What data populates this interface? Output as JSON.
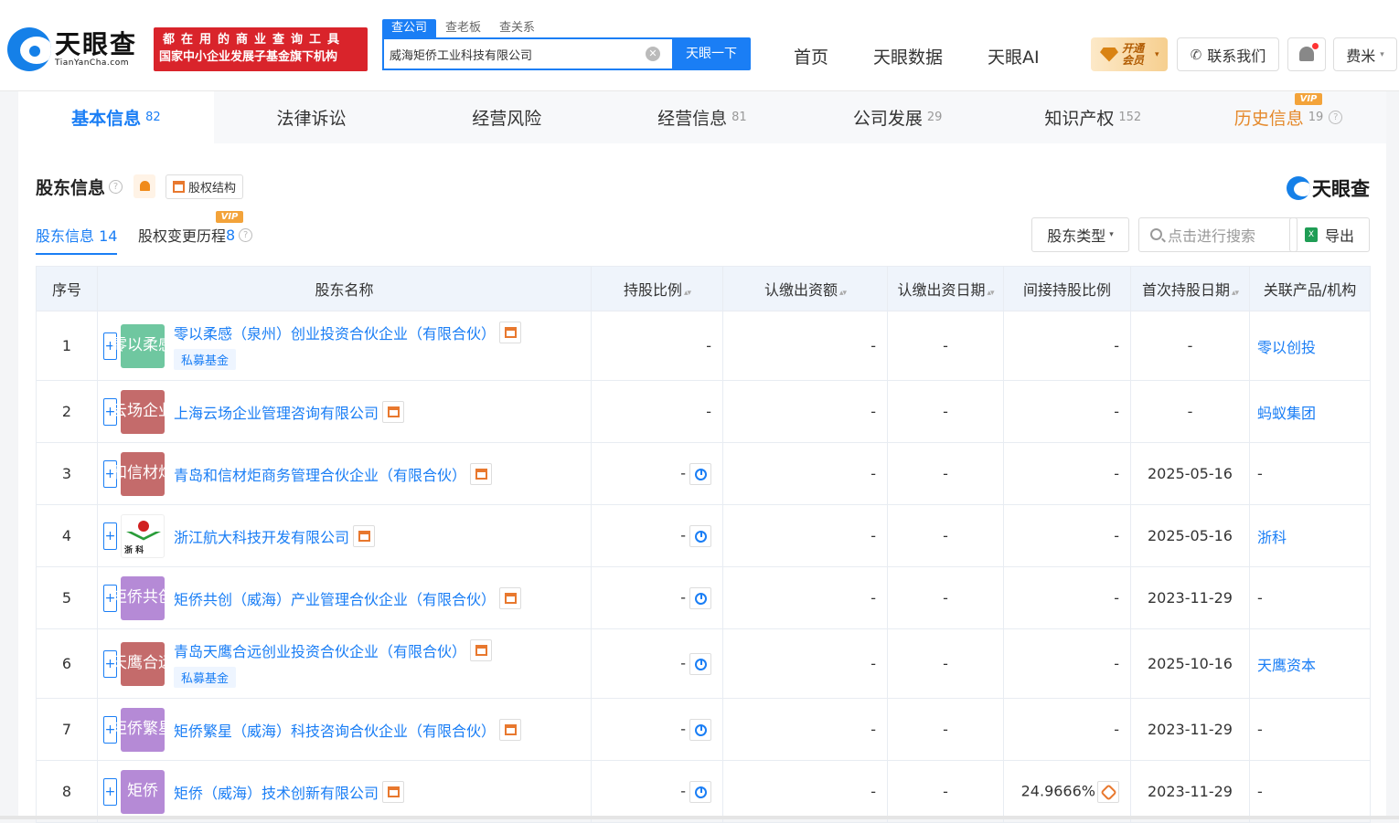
{
  "header": {
    "logo_title": "天眼查",
    "logo_sub": "TianYanCha.com",
    "banner_line1": "都在用的商业查询工具",
    "banner_line2": "国家中小企业发展子基金旗下机构",
    "search_tabs": [
      "查公司",
      "查老板",
      "查关系"
    ],
    "search_value": "威海矩侨工业科技有限公司",
    "search_button": "天眼一下",
    "nav": [
      "首页",
      "天眼数据",
      "天眼AI"
    ],
    "vip_label": "开通会员",
    "contact_label": "联系我们",
    "user_name": "费米"
  },
  "main_tabs": [
    {
      "label": "基本信息",
      "count": "82"
    },
    {
      "label": "法律诉讼",
      "count": ""
    },
    {
      "label": "经营风险",
      "count": ""
    },
    {
      "label": "经营信息",
      "count": "81"
    },
    {
      "label": "公司发展",
      "count": "29"
    },
    {
      "label": "知识产权",
      "count": "152"
    },
    {
      "label": "历史信息",
      "count": "19"
    }
  ],
  "vip_badge": "VIP",
  "section": {
    "title": "股东信息",
    "equity_button": "股权结构",
    "brand": "天眼查",
    "sub_tab1_label": "股东信息",
    "sub_tab1_count": "14",
    "sub_tab2_label": "股权变更历程",
    "sub_tab2_count": "8",
    "type_select": "股东类型",
    "search_placeholder": "点击进行搜索",
    "export_label": "导出"
  },
  "table": {
    "columns": [
      "序号",
      "股东名称",
      "持股比例",
      "认缴出资额",
      "认缴出资日期",
      "间接持股比例",
      "首次持股日期",
      "关联产品/机构"
    ],
    "rows": [
      {
        "idx": "1",
        "avatar": "零以柔感",
        "color": "#6fc7a0",
        "name": "零以柔感（泉州）创业投资合伙企业（有限合伙）",
        "tag": "私募基金",
        "ratio": "-",
        "amount": "-",
        "date": "-",
        "indirect": "-",
        "first_date": "-",
        "related": "零以创投"
      },
      {
        "idx": "2",
        "avatar": "云场企业",
        "color": "#c46b6b",
        "name": "上海云场企业管理咨询有限公司",
        "tag": "",
        "ratio": "-",
        "amount": "-",
        "date": "-",
        "indirect": "-",
        "first_date": "-",
        "related": "蚂蚁集团"
      },
      {
        "idx": "3",
        "avatar": "和信材炬",
        "color": "#c46b6b",
        "name": "青岛和信材炬商务管理合伙企业（有限合伙）",
        "tag": "",
        "ratio": "-",
        "amount": "-",
        "date": "-",
        "indirect": "-",
        "first_date": "2025-05-16",
        "related": "-"
      },
      {
        "idx": "4",
        "avatar": "",
        "color": "",
        "name": "浙江航大科技开发有限公司",
        "tag": "",
        "ratio": "-",
        "amount": "-",
        "date": "-",
        "indirect": "-",
        "first_date": "2025-05-16",
        "related": "浙科"
      },
      {
        "idx": "5",
        "avatar": "矩侨共创",
        "color": "#b58ad6",
        "name": "矩侨共创（威海）产业管理合伙企业（有限合伙）",
        "tag": "",
        "ratio": "-",
        "amount": "-",
        "date": "-",
        "indirect": "-",
        "first_date": "2023-11-29",
        "related": "-"
      },
      {
        "idx": "6",
        "avatar": "天鹰合远",
        "color": "#c46b6b",
        "name": "青岛天鹰合远创业投资合伙企业（有限合伙）",
        "tag": "私募基金",
        "ratio": "-",
        "amount": "-",
        "date": "-",
        "indirect": "-",
        "first_date": "2025-10-16",
        "related": "天鹰资本"
      },
      {
        "idx": "7",
        "avatar": "矩侨繁星",
        "color": "#b58ad6",
        "name": "矩侨繁星（威海）科技咨询合伙企业（有限合伙）",
        "tag": "",
        "ratio": "-",
        "amount": "-",
        "date": "-",
        "indirect": "-",
        "first_date": "2023-11-29",
        "related": "-"
      },
      {
        "idx": "8",
        "avatar": "矩侨",
        "color": "#b58ad6",
        "name": "矩侨（威海）技术创新有限公司",
        "tag": "",
        "ratio": "-",
        "amount": "-",
        "date": "-",
        "indirect": "24.9666%",
        "first_date": "2023-11-29",
        "related": "-"
      }
    ],
    "avatar4_text": "浙 科"
  },
  "colors": {
    "accent": "#1a7ef5",
    "history_tab": "#e5892b",
    "banner": "#d9242b"
  }
}
